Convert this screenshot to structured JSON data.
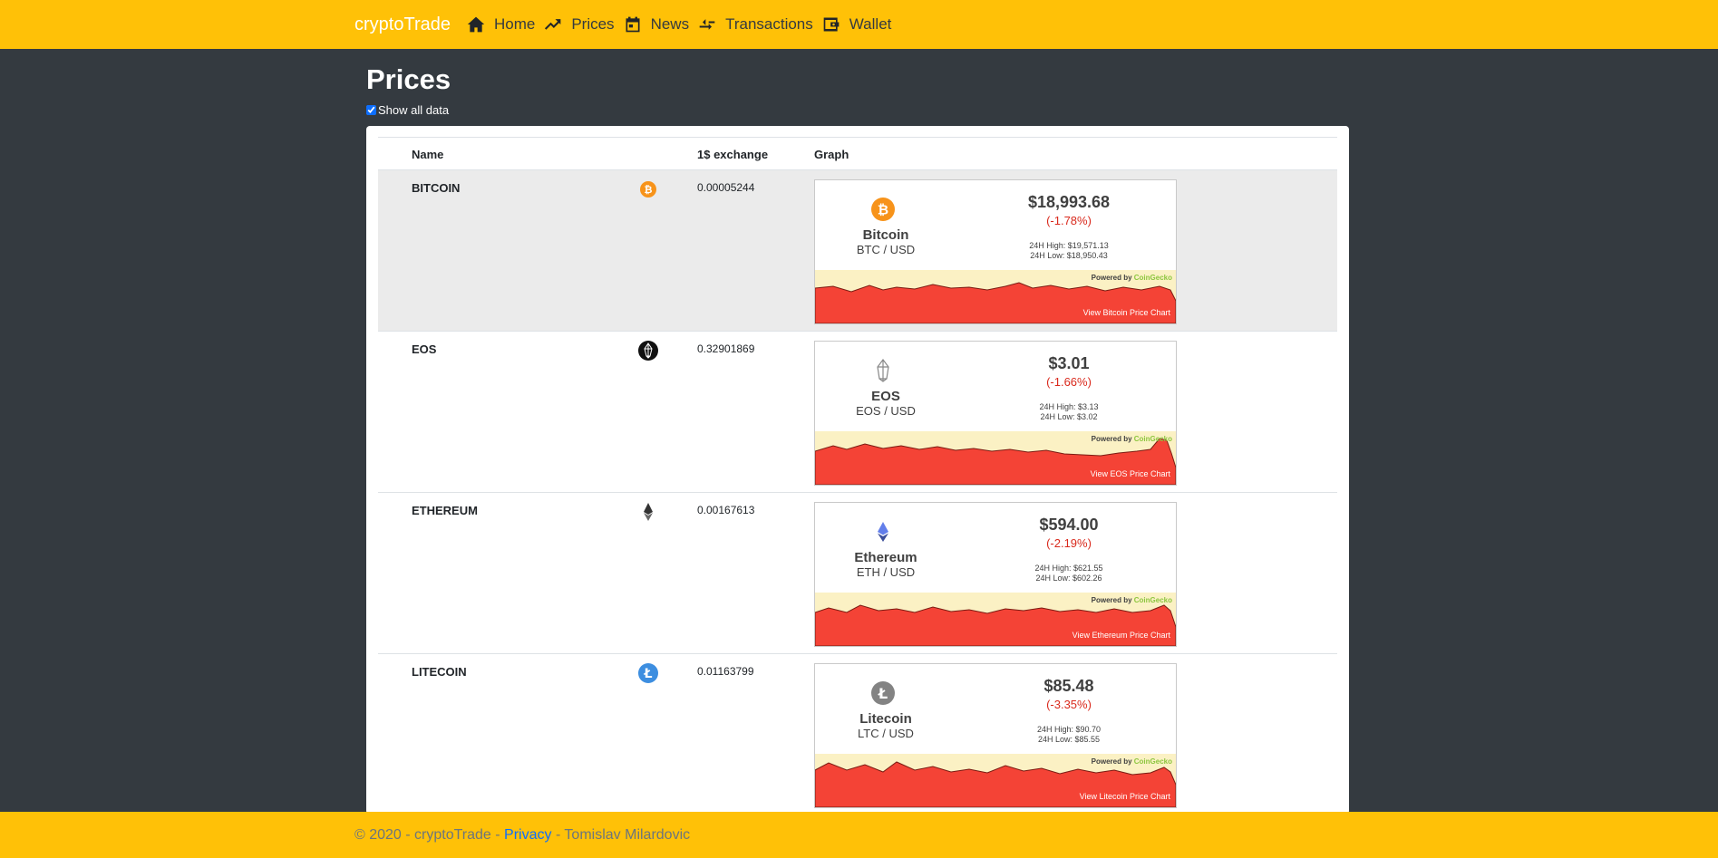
{
  "nav": {
    "brand": "cryptoTrade",
    "items": [
      {
        "label": "Home",
        "icon": "home-icon"
      },
      {
        "label": "Prices",
        "icon": "trending-up-icon"
      },
      {
        "label": "News",
        "icon": "calendar-icon"
      },
      {
        "label": "Transactions",
        "icon": "exchange-icon"
      },
      {
        "label": "Wallet",
        "icon": "wallet-icon"
      }
    ]
  },
  "page": {
    "title": "Prices",
    "show_all_label": "Show all data",
    "show_all_checked": true
  },
  "table": {
    "headers": {
      "name": "Name",
      "exchange": "1$ exchange",
      "graph": "Graph"
    },
    "rows": [
      {
        "name": "BITCOIN",
        "icon": "bitcoin-icon",
        "rate": "0.00005244",
        "widget": {
          "coin": "Bitcoin",
          "pair": "BTC / USD",
          "price": "$18,993.68",
          "change": "(-1.78%)",
          "high": "24H High: $19,571.13",
          "low": "24H Low: $18,950.43",
          "powered": "Powered by",
          "provider": "CoinGecko",
          "link": "View Bitcoin Price Chart"
        }
      },
      {
        "name": "EOS",
        "icon": "eos-icon",
        "rate": "0.32901869",
        "widget": {
          "coin": "EOS",
          "pair": "EOS / USD",
          "price": "$3.01",
          "change": "(-1.66%)",
          "high": "24H High: $3.13",
          "low": "24H Low: $3.02",
          "powered": "Powered by",
          "provider": "CoinGecko",
          "link": "View EOS Price Chart"
        }
      },
      {
        "name": "ETHEREUM",
        "icon": "ethereum-icon",
        "rate": "0.00167613",
        "widget": {
          "coin": "Ethereum",
          "pair": "ETH / USD",
          "price": "$594.00",
          "change": "(-2.19%)",
          "high": "24H High: $621.55",
          "low": "24H Low: $602.26",
          "powered": "Powered by",
          "provider": "CoinGecko",
          "link": "View Ethereum Price Chart"
        }
      },
      {
        "name": "LITECOIN",
        "icon": "litecoin-icon",
        "rate": "0.01163799",
        "widget": {
          "coin": "Litecoin",
          "pair": "LTC / USD",
          "price": "$85.48",
          "change": "(-3.35%)",
          "high": "24H High: $90.70",
          "low": "24H Low: $85.55",
          "powered": "Powered by",
          "provider": "CoinGecko",
          "link": "View Litecoin Price Chart"
        }
      }
    ]
  },
  "footer": {
    "copyright": "© 2020 - cryptoTrade - ",
    "privacy": "Privacy",
    "author": " - Tomislav Milardovic"
  },
  "colors": {
    "accent": "#ffc107",
    "background": "#343a40",
    "negative": "#d9291c",
    "chart_fill": "#f44336"
  }
}
